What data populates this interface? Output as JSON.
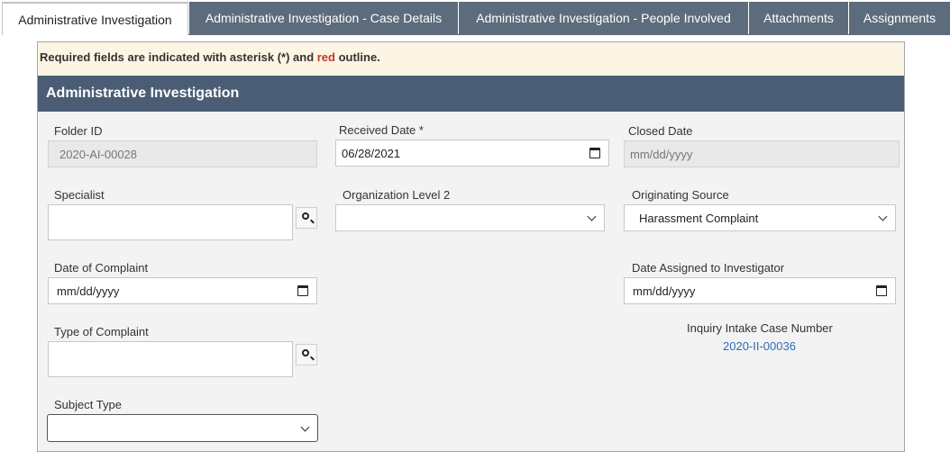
{
  "tabs": [
    {
      "label": "Administrative Investigation",
      "active": true
    },
    {
      "label": "Administrative Investigation - Case Details",
      "active": false
    },
    {
      "label": "Administrative Investigation - People Involved",
      "active": false
    },
    {
      "label": "Attachments",
      "active": false
    },
    {
      "label": "Assignments",
      "active": false
    }
  ],
  "notice": {
    "prefix": "Required fields are indicated with asterisk (*) and ",
    "red_word": "red",
    "suffix": " outline."
  },
  "section_title": "Administrative Investigation",
  "fields": {
    "folder_id": {
      "label": "Folder ID",
      "value": "2020-AI-00028"
    },
    "received_date": {
      "label": "Received Date *",
      "value": "06/28/2021"
    },
    "closed_date": {
      "label": "Closed Date",
      "value": "mm/dd/yyyy"
    },
    "specialist": {
      "label": "Specialist",
      "value": ""
    },
    "org_level_2": {
      "label": "Organization Level 2",
      "value": ""
    },
    "originating_source": {
      "label": "Originating Source",
      "value": "Harassment Complaint"
    },
    "date_of_complaint": {
      "label": "Date of Complaint",
      "value": "mm/dd/yyyy"
    },
    "date_assigned": {
      "label": "Date Assigned to Investigator",
      "value": "mm/dd/yyyy"
    },
    "type_of_complaint": {
      "label": "Type of Complaint",
      "value": ""
    },
    "inquiry_intake": {
      "label": "Inquiry Intake Case Number",
      "value": "2020-II-00036"
    },
    "subject_type": {
      "label": "Subject Type",
      "value": ""
    }
  },
  "colors": {
    "tab_inactive": "#5d6c7c",
    "section_header": "#4a5d74",
    "notice_bg": "#fdf5e3",
    "required_red": "#c0392b",
    "link": "#2a6ebb"
  }
}
